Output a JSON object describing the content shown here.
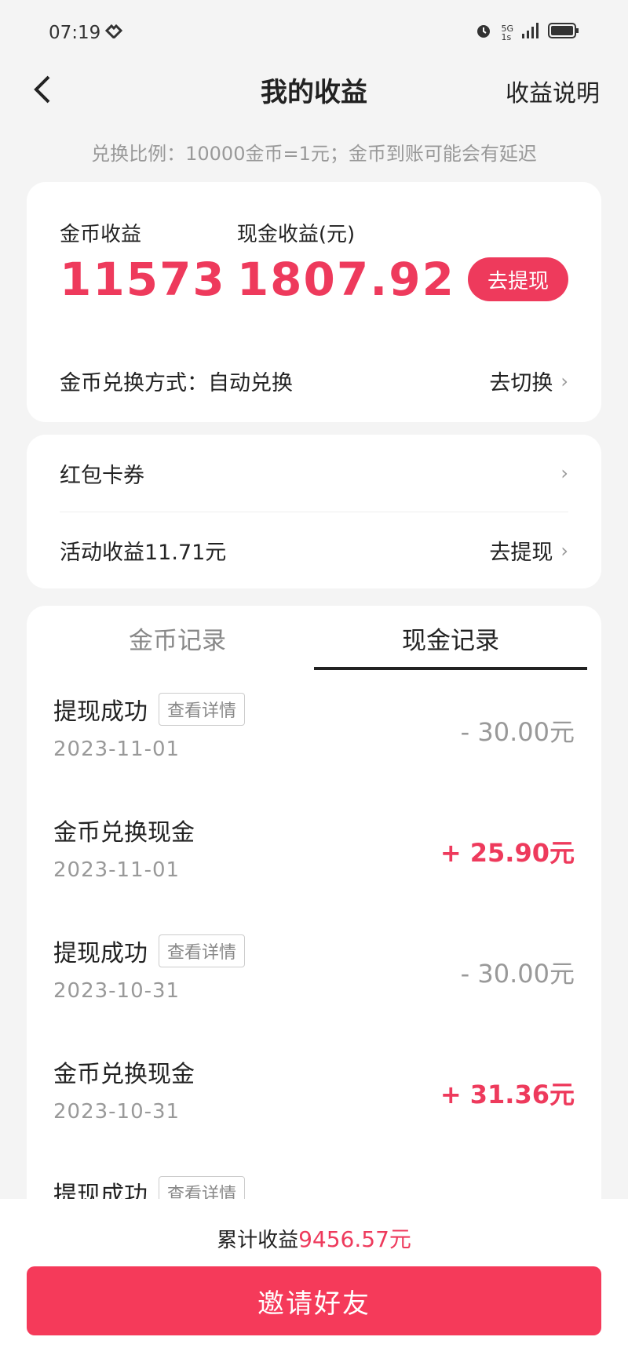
{
  "status_bar": {
    "time": "07:19",
    "network_top": "5G",
    "network_bottom": "1s"
  },
  "nav": {
    "title": "我的收益",
    "help_label": "收益说明"
  },
  "exchange_note": "兑换比例：10000金币=1元；金币到账可能会有延迟",
  "balance": {
    "coin_label": "金币收益",
    "coin_value": "11573",
    "cash_label": "现金收益(元)",
    "cash_value": "1807.92",
    "withdraw_label": "去提现",
    "exchange_mode_label": "金币兑换方式：自动兑换",
    "exchange_mode_action": "去切换"
  },
  "list": {
    "items": [
      {
        "label": "红包卡券",
        "action": ""
      },
      {
        "label": "活动收益11.71元",
        "action": "去提现"
      }
    ]
  },
  "records": {
    "tabs": [
      {
        "label": "金币记录",
        "active": false
      },
      {
        "label": "现金记录",
        "active": true
      }
    ],
    "detail_tag": "查看详情",
    "items": [
      {
        "title": "提现成功",
        "date": "2023-11-01",
        "amount": "- 30.00元",
        "type": "neg",
        "has_detail": true
      },
      {
        "title": "金币兑换现金",
        "date": "2023-11-01",
        "amount": "+ 25.90元",
        "type": "pos",
        "has_detail": false
      },
      {
        "title": "提现成功",
        "date": "2023-10-31",
        "amount": "- 30.00元",
        "type": "neg",
        "has_detail": true
      },
      {
        "title": "金币兑换现金",
        "date": "2023-10-31",
        "amount": "+ 31.36元",
        "type": "pos",
        "has_detail": false
      },
      {
        "title": "提现成功",
        "date": "",
        "amount": "",
        "type": "neg",
        "has_detail": true
      }
    ]
  },
  "footer": {
    "total_label": "累计收益",
    "total_value": "9456.57元",
    "invite_label": "邀请好友"
  },
  "colors": {
    "accent": "#ee3a5c",
    "background": "#f4f4f4",
    "muted": "#999999"
  }
}
